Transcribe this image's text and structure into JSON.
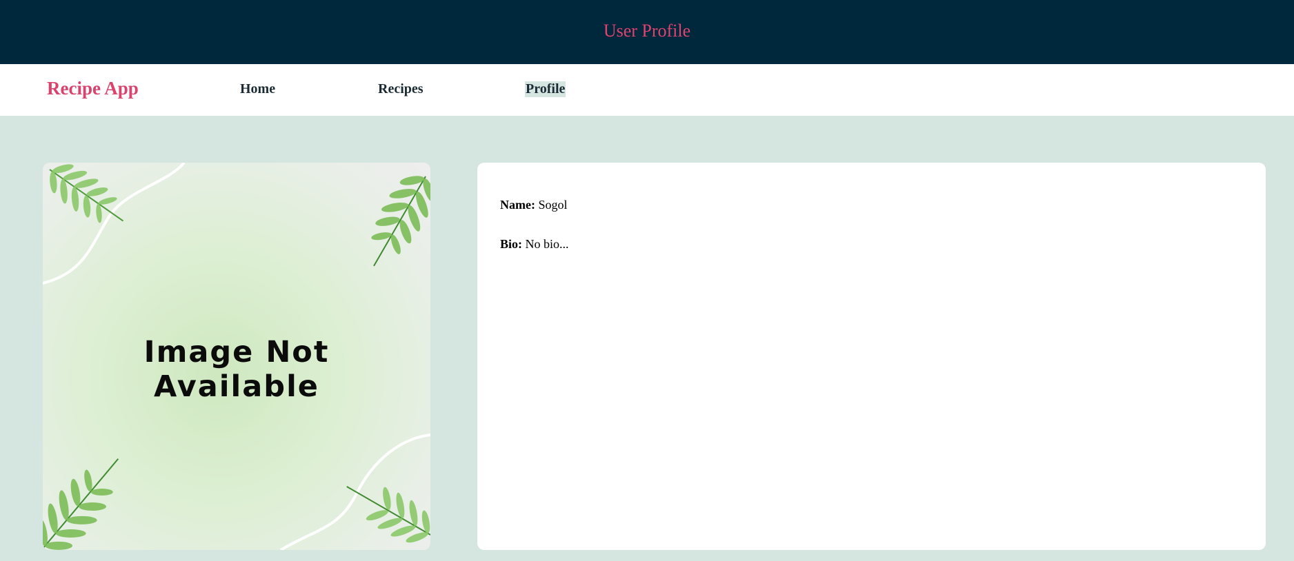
{
  "header": {
    "title": "User Profile"
  },
  "navbar": {
    "brand": "Recipe App",
    "links": [
      {
        "label": "Home",
        "active": false
      },
      {
        "label": "Recipes",
        "active": false
      },
      {
        "label": "Profile",
        "active": true
      }
    ]
  },
  "profile": {
    "image_placeholder": {
      "line1": "Image Not",
      "line2": "Available"
    },
    "name_label": "Name:",
    "name_value": "Sogol",
    "bio_label": "Bio:",
    "bio_value": "No bio..."
  },
  "colors": {
    "banner_bg": "#00283c",
    "accent": "#e0436e",
    "page_bg": "#d5e5e0",
    "card_bg": "#ffffff"
  }
}
